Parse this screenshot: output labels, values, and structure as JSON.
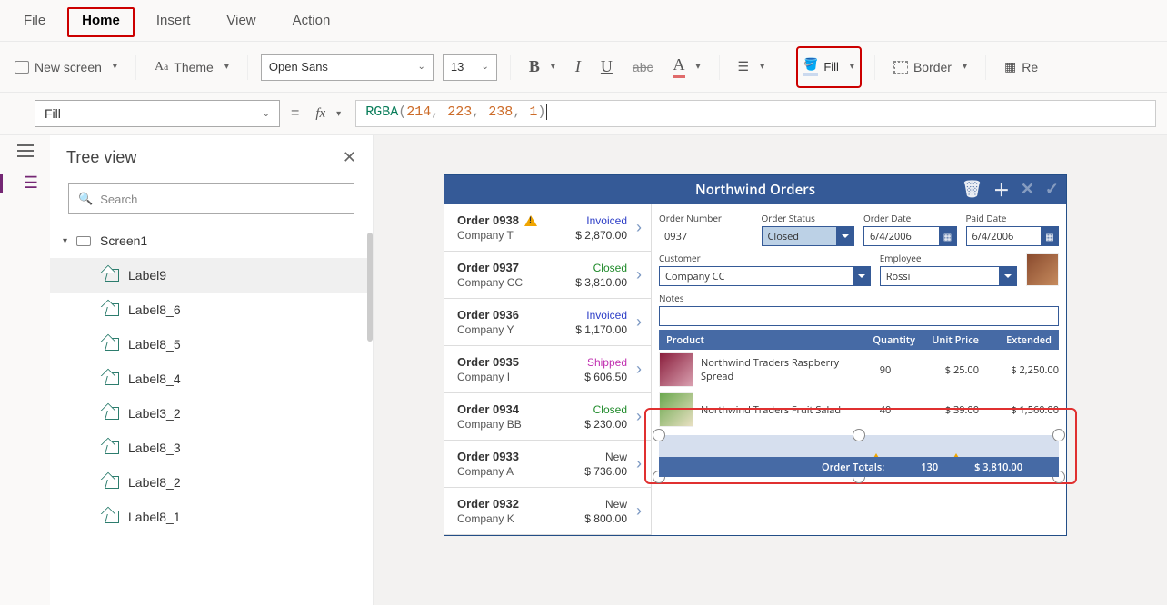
{
  "tabs": {
    "file": "File",
    "home": "Home",
    "insert": "Insert",
    "view": "View",
    "action": "Action"
  },
  "ribbon": {
    "new_screen": "New screen",
    "theme": "Theme",
    "font": "Open Sans",
    "font_size": "13",
    "fill": "Fill",
    "border": "Border",
    "reorder": "Re"
  },
  "formula": {
    "property": "Fill",
    "fn": "RGBA",
    "a": "214",
    "b": "223",
    "c": "238",
    "d": "1"
  },
  "tree": {
    "title": "Tree view",
    "search_ph": "Search",
    "screen": "Screen1",
    "items": [
      "Label9",
      "Label8_6",
      "Label8_5",
      "Label8_4",
      "Label3_2",
      "Label8_3",
      "Label8_2",
      "Label8_1"
    ]
  },
  "app": {
    "title": "Northwind Orders",
    "orders": [
      {
        "no": "Order 0938",
        "co": "Company T",
        "status": "Invoiced",
        "statusCls": "st-invoiced",
        "amount": "$ 2,870.00",
        "warn": true
      },
      {
        "no": "Order 0937",
        "co": "Company CC",
        "status": "Closed",
        "statusCls": "st-closed",
        "amount": "$ 3,810.00"
      },
      {
        "no": "Order 0936",
        "co": "Company Y",
        "status": "Invoiced",
        "statusCls": "st-invoiced",
        "amount": "$ 1,170.00"
      },
      {
        "no": "Order 0935",
        "co": "Company I",
        "status": "Shipped",
        "statusCls": "st-shipped",
        "amount": "$ 606.50"
      },
      {
        "no": "Order 0934",
        "co": "Company BB",
        "status": "Closed",
        "statusCls": "st-closed",
        "amount": "$ 230.00"
      },
      {
        "no": "Order 0933",
        "co": "Company A",
        "status": "New",
        "statusCls": "st-new",
        "amount": "$ 736.00"
      },
      {
        "no": "Order 0932",
        "co": "Company K",
        "status": "New",
        "statusCls": "st-new",
        "amount": "$ 800.00"
      }
    ],
    "fld_labels": {
      "ono": "Order Number",
      "ost": "Order Status",
      "odt": "Order Date",
      "pdt": "Paid Date",
      "cust": "Customer",
      "emp": "Employee",
      "notes": "Notes"
    },
    "fld_values": {
      "ono": "0937",
      "ost": "Closed",
      "odt": "6/4/2006",
      "pdt": "6/4/2006",
      "cust": "Company CC",
      "emp": "Rossi"
    },
    "prod_header": {
      "p": "Product",
      "q": "Quantity",
      "u": "Unit Price",
      "e": "Extended"
    },
    "products": [
      {
        "name": "Northwind Traders Raspberry Spread",
        "qty": "90",
        "price": "$ 25.00",
        "ext": "$ 2,250.00",
        "thumb": "berry"
      },
      {
        "name": "Northwind Traders Fruit Salad",
        "qty": "40",
        "price": "$ 39.00",
        "ext": "$ 1,560.00",
        "thumb": "salad"
      }
    ],
    "totals": {
      "label": "Order Totals:",
      "qty": "130",
      "amount": "$ 3,810.00"
    }
  }
}
